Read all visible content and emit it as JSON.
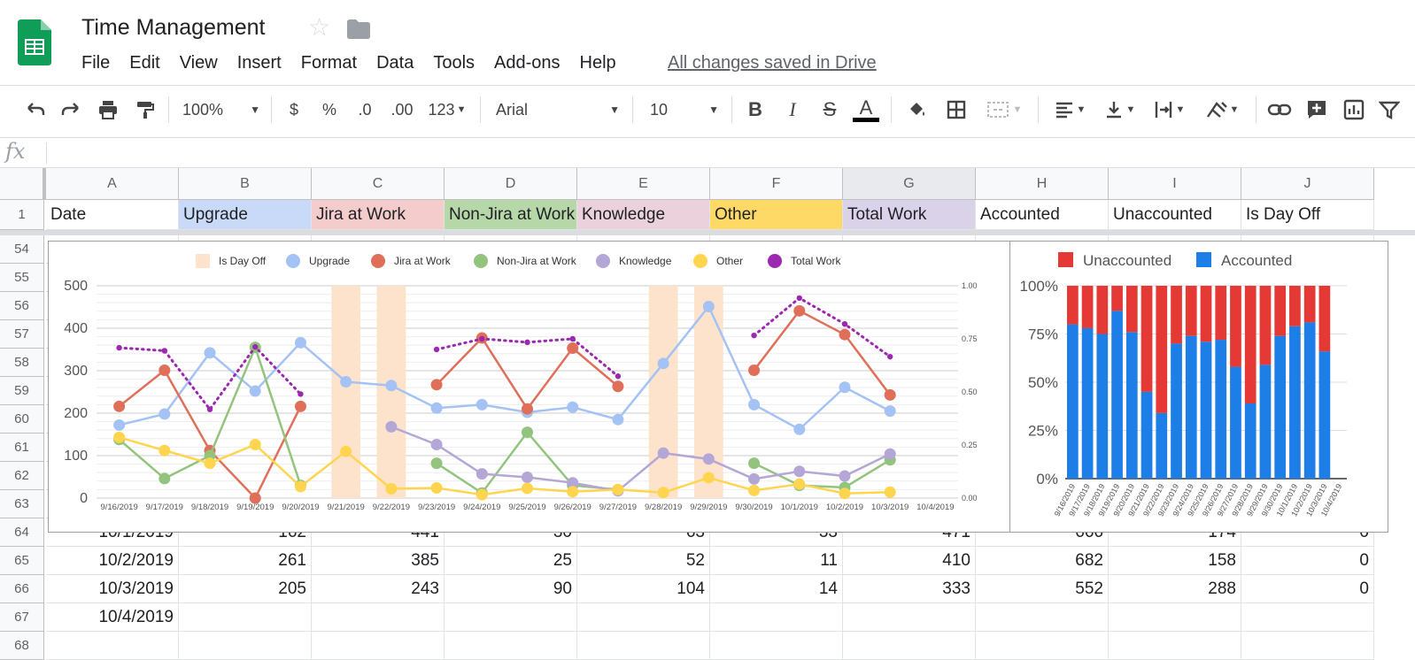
{
  "app": {
    "doc_title": "Time Management",
    "saved_status": "All changes saved in Drive",
    "menu": [
      "File",
      "Edit",
      "View",
      "Insert",
      "Format",
      "Data",
      "Tools",
      "Add-ons",
      "Help"
    ]
  },
  "toolbar": {
    "zoom": "100%",
    "currency": "$",
    "percent": "%",
    "dec_decrease": ".0",
    "dec_increase": ".00",
    "more_formats": "123",
    "font": "Arial",
    "font_size": "10",
    "bold": "B",
    "italic": "I",
    "strike": "S",
    "text_color": "A"
  },
  "formula_bar": {
    "label": "fx",
    "value": ""
  },
  "sheet": {
    "columns": [
      "A",
      "B",
      "C",
      "D",
      "E",
      "F",
      "G",
      "H",
      "I",
      "J"
    ],
    "header_row": {
      "row_label": "1",
      "cells": [
        "Date",
        "Upgrade",
        "Jira at Work",
        "Non-Jira at Work",
        "Knowledge",
        "Other",
        "Total Work",
        "Accounted",
        "Unaccounted",
        "Is Day Off"
      ],
      "colors": [
        "#ffffff",
        "#c9daf8",
        "#f4cccc",
        "#b6d7a8",
        "#ead1dc",
        "#ffd966",
        "#d9d2e9",
        "#ffffff",
        "#ffffff",
        "#ffffff"
      ]
    },
    "row_labels": [
      "54",
      "55",
      "56",
      "57",
      "58",
      "59",
      "60",
      "61",
      "62",
      "63",
      "64",
      "65",
      "66",
      "67",
      "68"
    ],
    "visible_rows": [
      {
        "row": "64",
        "cells": [
          "10/1/2019",
          "162",
          "441",
          "30",
          "63",
          "33",
          "471",
          "666",
          "174",
          "0"
        ]
      },
      {
        "row": "65",
        "cells": [
          "10/2/2019",
          "261",
          "385",
          "25",
          "52",
          "11",
          "410",
          "682",
          "158",
          "0"
        ]
      },
      {
        "row": "66",
        "cells": [
          "10/3/2019",
          "205",
          "243",
          "90",
          "104",
          "14",
          "333",
          "552",
          "288",
          "0"
        ]
      },
      {
        "row": "67",
        "cells": [
          "10/4/2019",
          "",
          "",
          "",
          "",
          "",
          "",
          "",
          "",
          ""
        ]
      }
    ]
  },
  "chart_data": [
    {
      "type": "line",
      "title": "",
      "x": [
        "9/16/2019",
        "9/17/2019",
        "9/18/2019",
        "9/19/2019",
        "9/20/2019",
        "9/21/2019",
        "9/22/2019",
        "9/23/2019",
        "9/24/2019",
        "9/25/2019",
        "9/26/2019",
        "9/27/2019",
        "9/28/2019",
        "9/29/2019",
        "9/30/2019",
        "10/1/2019",
        "10/2/2019",
        "10/3/2019",
        "10/4/2019"
      ],
      "ylim": [
        0,
        500
      ],
      "yticks": [
        "500",
        "400",
        "300",
        "200",
        "100",
        "0"
      ],
      "y2lim": [
        0,
        1
      ],
      "y2ticks": [
        "1.00",
        "0.75",
        "0.50",
        "0.25",
        "0.00"
      ],
      "legend": [
        "Is Day Off",
        "Upgrade",
        "Jira at Work",
        "Non-Jira at Work",
        "Knowledge",
        "Other",
        "Total Work"
      ],
      "legend_position": "top",
      "day_off": [
        0,
        0,
        0,
        0,
        0,
        1,
        1,
        0,
        0,
        0,
        0,
        0,
        1,
        1,
        0,
        0,
        0,
        0,
        0
      ],
      "series": [
        {
          "name": "Upgrade",
          "color": "#a4c2f4",
          "style": "line",
          "values": [
            172,
            198,
            342,
            252,
            366,
            274,
            265,
            212,
            220,
            202,
            214,
            185,
            317,
            451,
            220,
            162,
            261,
            205,
            null
          ]
        },
        {
          "name": "Jira at Work",
          "color": "#e06f5a",
          "style": "line",
          "values": [
            216,
            301,
            112,
            0,
            216,
            null,
            null,
            267,
            377,
            210,
            353,
            263,
            null,
            null,
            301,
            441,
            385,
            243,
            null
          ]
        },
        {
          "name": "Non-Jira at Work",
          "color": "#93c47d",
          "style": "line",
          "values": [
            138,
            46,
            100,
            355,
            30,
            null,
            null,
            82,
            12,
            155,
            30,
            20,
            null,
            null,
            82,
            30,
            25,
            90,
            null
          ]
        },
        {
          "name": "Knowledge",
          "color": "#b4a7d6",
          "style": "line",
          "values": [
            null,
            null,
            null,
            null,
            null,
            null,
            168,
            126,
            57,
            49,
            36,
            17,
            106,
            92,
            45,
            63,
            52,
            104,
            null
          ]
        },
        {
          "name": "Other",
          "color": "#ffd54f",
          "style": "line",
          "values": [
            143,
            112,
            82,
            126,
            27,
            110,
            22,
            24,
            8,
            23,
            15,
            20,
            13,
            48,
            18,
            33,
            11,
            14,
            null
          ]
        },
        {
          "name": "Total Work",
          "color": "#9c27b0",
          "style": "dotted",
          "values": [
            354,
            347,
            209,
            356,
            245,
            null,
            null,
            350,
            375,
            367,
            375,
            287,
            null,
            null,
            383,
            471,
            410,
            333,
            null
          ]
        }
      ]
    },
    {
      "type": "bar",
      "stacked": true,
      "title": "",
      "categories": [
        "9/16/2019",
        "9/17/2019",
        "9/18/2019",
        "9/19/2019",
        "9/20/2019",
        "9/21/2019",
        "9/22/2019",
        "9/23/2019",
        "9/24/2019",
        "9/25/2019",
        "9/26/2019",
        "9/27/2019",
        "9/28/2019",
        "9/29/2019",
        "9/30/2019",
        "10/1/2019",
        "10/2/2019",
        "10/3/2019",
        "10/4/2019"
      ],
      "ylim": [
        0,
        100
      ],
      "yticks": [
        "100%",
        "75%",
        "50%",
        "25%",
        "0%"
      ],
      "legend": [
        "Unaccounted",
        "Accounted"
      ],
      "legend_position": "top",
      "series": [
        {
          "name": "Accounted",
          "color": "#1e7ee8",
          "values": [
            80,
            78,
            75,
            87,
            76,
            45,
            34,
            70,
            74,
            71,
            72,
            58,
            39,
            59,
            74,
            79,
            81,
            66,
            0
          ]
        },
        {
          "name": "Unaccounted",
          "color": "#e53935",
          "values": [
            20,
            22,
            25,
            13,
            24,
            55,
            66,
            30,
            26,
            29,
            28,
            42,
            61,
            41,
            26,
            21,
            19,
            34,
            0
          ]
        }
      ]
    }
  ]
}
